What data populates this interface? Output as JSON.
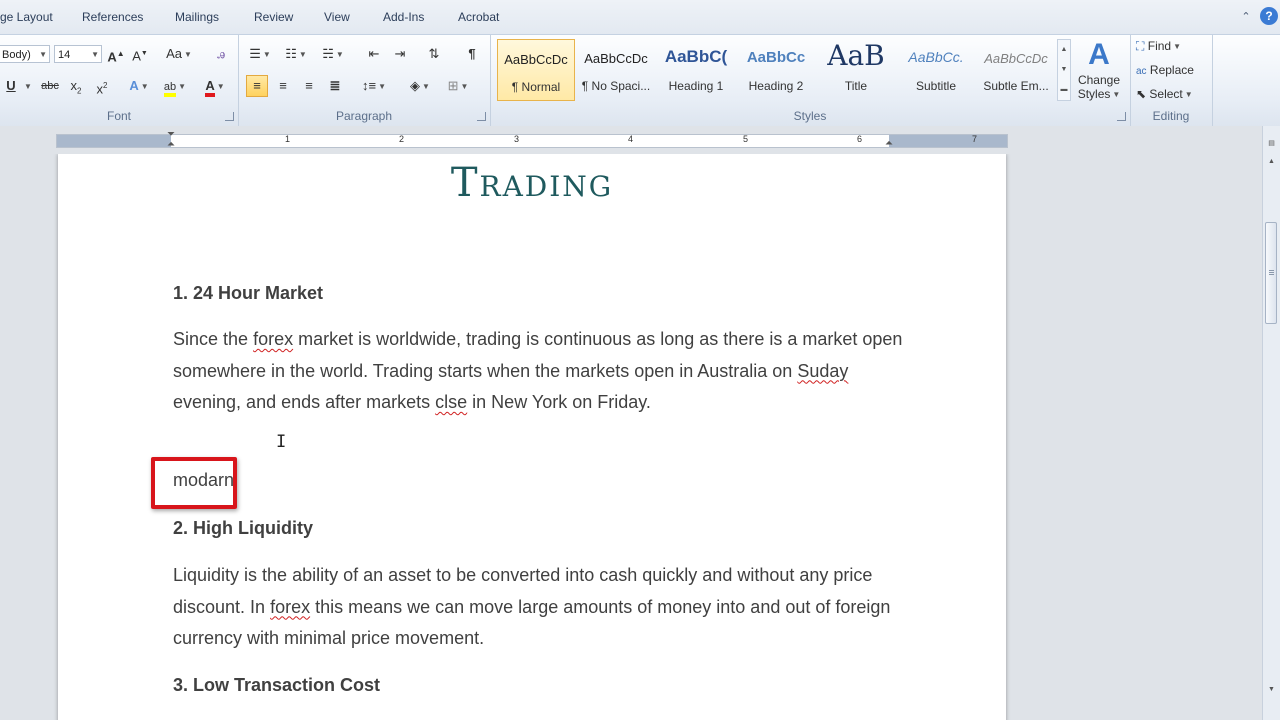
{
  "ribbon_tabs": [
    "ge Layout",
    "References",
    "Mailings",
    "Review",
    "View",
    "Add-Ins",
    "Acrobat"
  ],
  "window_controls": {
    "minimize": "⌃",
    "help": "?"
  },
  "font_group": {
    "font_name": "Body)",
    "font_size": "14",
    "label": "Font"
  },
  "paragraph_group": {
    "label": "Paragraph"
  },
  "styles_group": {
    "label": "Styles",
    "styles": [
      {
        "sample": "AaBbCcDc",
        "name": "¶ Normal"
      },
      {
        "sample": "AaBbCcDc",
        "name": "¶ No Spaci..."
      },
      {
        "sample": "AaBbC(",
        "name": "Heading 1"
      },
      {
        "sample": "AaBbCc",
        "name": "Heading 2"
      },
      {
        "sample": "AaB",
        "name": "Title"
      },
      {
        "sample": "AaBbCc.",
        "name": "Subtitle"
      },
      {
        "sample": "AaBbCcDc",
        "name": "Subtle Em..."
      }
    ],
    "change_styles_line1": "Change",
    "change_styles_line2": "Styles"
  },
  "editing_group": {
    "label": "Editing",
    "find": "Find",
    "replace": "Replace",
    "select": "Select"
  },
  "ruler_numbers": [
    "1",
    "2",
    "3",
    "4",
    "5",
    "6",
    "7"
  ],
  "document": {
    "title": "Trading",
    "section1_heading": "1. 24 Hour Market",
    "p1": {
      "s1": "Since the ",
      "typo1": "forex",
      "s2": " market is worldwide, trading is continuous as long as there is a market open somewhere in the world. Trading starts when the markets open in Australia on ",
      "typo2": "Suday",
      "s3": " evening, and ends after markets ",
      "typo3": "clse",
      "s4": " in New York on Friday."
    },
    "highlighted_word": "modarn",
    "section2_heading": "2. High Liquidity",
    "p2": {
      "s1": "Liquidity is the ability of an asset to be converted into cash quickly and without any price discount. In ",
      "typo1": "forex",
      "s2": " this means we can move large amounts of money into and out of foreign currency with minimal price movement."
    },
    "section3_heading": "3. Low Transaction Cost"
  },
  "colors": {
    "title": "#1f5a5e",
    "body_text": "#404040",
    "highlight_box": "#d8151b",
    "spelling_underline": "#d02020"
  }
}
